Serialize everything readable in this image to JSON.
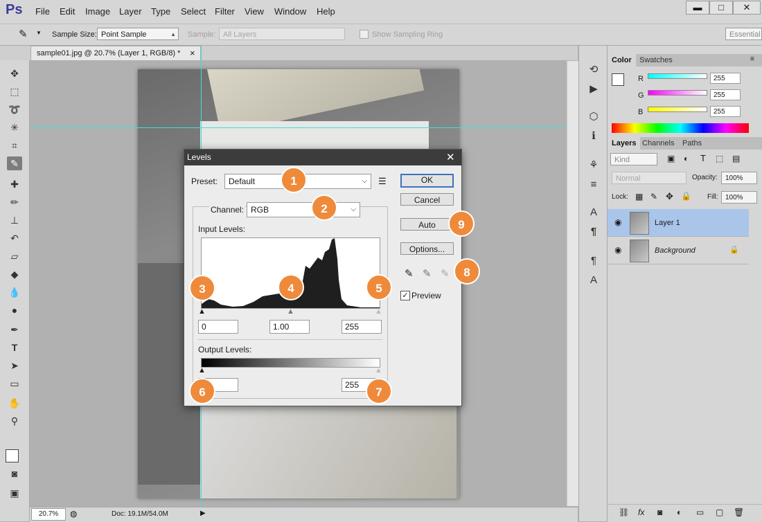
{
  "app": {
    "logo": "Ps"
  },
  "menu": [
    "File",
    "Edit",
    "Image",
    "Layer",
    "Type",
    "Select",
    "Filter",
    "View",
    "Window",
    "Help"
  ],
  "window_controls": {
    "minimize": "▬",
    "maximize": "□",
    "close": "✕"
  },
  "options_bar": {
    "sample_size_label": "Sample Size:",
    "sample_size_value": "Point Sample",
    "sample_label": "Sample:",
    "sample_value": "All Layers",
    "show_ring_label": "Show Sampling Ring",
    "workspace": "Essential"
  },
  "document": {
    "tab_title": "sample01.jpg @ 20.7% (Layer 1, RGB/8) *",
    "close": "×"
  },
  "status": {
    "zoom": "20.7%",
    "doc": "Doc: 19.1M/54.0M"
  },
  "color_panel": {
    "tabs": [
      "Color",
      "Swatches"
    ],
    "channels": [
      {
        "label": "R",
        "value": "255"
      },
      {
        "label": "G",
        "value": "255"
      },
      {
        "label": "B",
        "value": "255"
      }
    ]
  },
  "layers_panel": {
    "tabs": [
      "Layers",
      "Channels",
      "Paths"
    ],
    "kind": "Kind",
    "blend_mode": "Normal",
    "opacity_label": "Opacity:",
    "opacity": "100%",
    "lock_label": "Lock:",
    "fill_label": "Fill:",
    "fill": "100%",
    "layers": [
      {
        "name": "Layer 1"
      },
      {
        "name": "Background"
      }
    ]
  },
  "levels": {
    "title": "Levels",
    "preset_label": "Preset:",
    "preset_value": "Default",
    "channel_label": "Channel:",
    "channel_value": "RGB",
    "input_levels_label": "Input Levels:",
    "input_black": "0",
    "input_gamma": "1.00",
    "input_white": "255",
    "output_levels_label": "Output Levels:",
    "output_black": "",
    "output_white": "255",
    "ok": "OK",
    "cancel": "Cancel",
    "auto": "Auto",
    "options": "Options...",
    "preview_label": "Preview",
    "preview_checked": true
  },
  "callouts": [
    "1",
    "2",
    "3",
    "4",
    "5",
    "6",
    "7",
    "8",
    "9"
  ]
}
